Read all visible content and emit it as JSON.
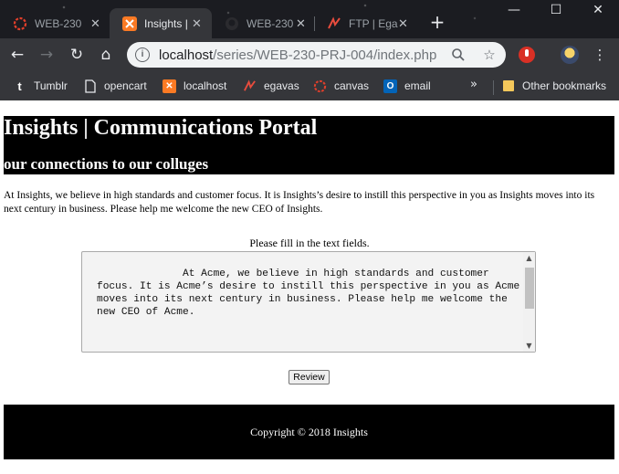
{
  "browser": {
    "tabs": [
      {
        "label": "WEB-230",
        "active": false
      },
      {
        "label": "Insights |",
        "active": true
      },
      {
        "label": "WEB-230",
        "active": false
      },
      {
        "label": "FTP | Ega",
        "active": false
      }
    ],
    "tab_close_glyph": "✕",
    "new_tab_glyph": "+",
    "window_controls": {
      "minimize": "—",
      "maximize": "☐",
      "close": "✕"
    },
    "nav": {
      "back": "←",
      "forward": "→",
      "reload": "↻",
      "home": "⌂"
    },
    "address": {
      "host": "localhost",
      "path": "/series/WEB-230-PRJ-004/index.php"
    },
    "bookmarks": [
      {
        "label": "Tumblr",
        "icon": "tumblr-icon"
      },
      {
        "label": "opencart",
        "icon": "page-icon"
      },
      {
        "label": "localhost",
        "icon": "xampp-icon"
      },
      {
        "label": "egavas",
        "icon": "egavas-icon"
      },
      {
        "label": "canvas",
        "icon": "canvas-icon"
      },
      {
        "label": "email",
        "icon": "outlook-icon"
      }
    ],
    "bookmarks_overflow": "»",
    "other_bookmarks": "Other bookmarks",
    "accent_colors": {
      "frame": "#202124",
      "toolbar": "#35363a",
      "omnibox": "#f1f3f4",
      "xampp": "#fb7a24",
      "canvas": "#e13f2b",
      "outlook": "#0364b8"
    }
  },
  "page": {
    "title": "Insights | Communications Portal",
    "subtitle": "our connections to our colluges",
    "intro": "At Insights, we believe in high standards and customer focus. It is Insights’s desire to instill this perspective in you as Insights moves into its next century in business. Please help me welcome the new CEO of Insights.",
    "form_label": "Please fill in the text fields.",
    "textarea_value": "              At Acme, we believe in high standards and customer focus. It is Acme’s desire to instill this perspective in you as Acme moves into its next century in business. Please help me welcome the new CEO of Acme.",
    "review_button": "Review",
    "footer": "Copyright © 2018 Insights"
  }
}
